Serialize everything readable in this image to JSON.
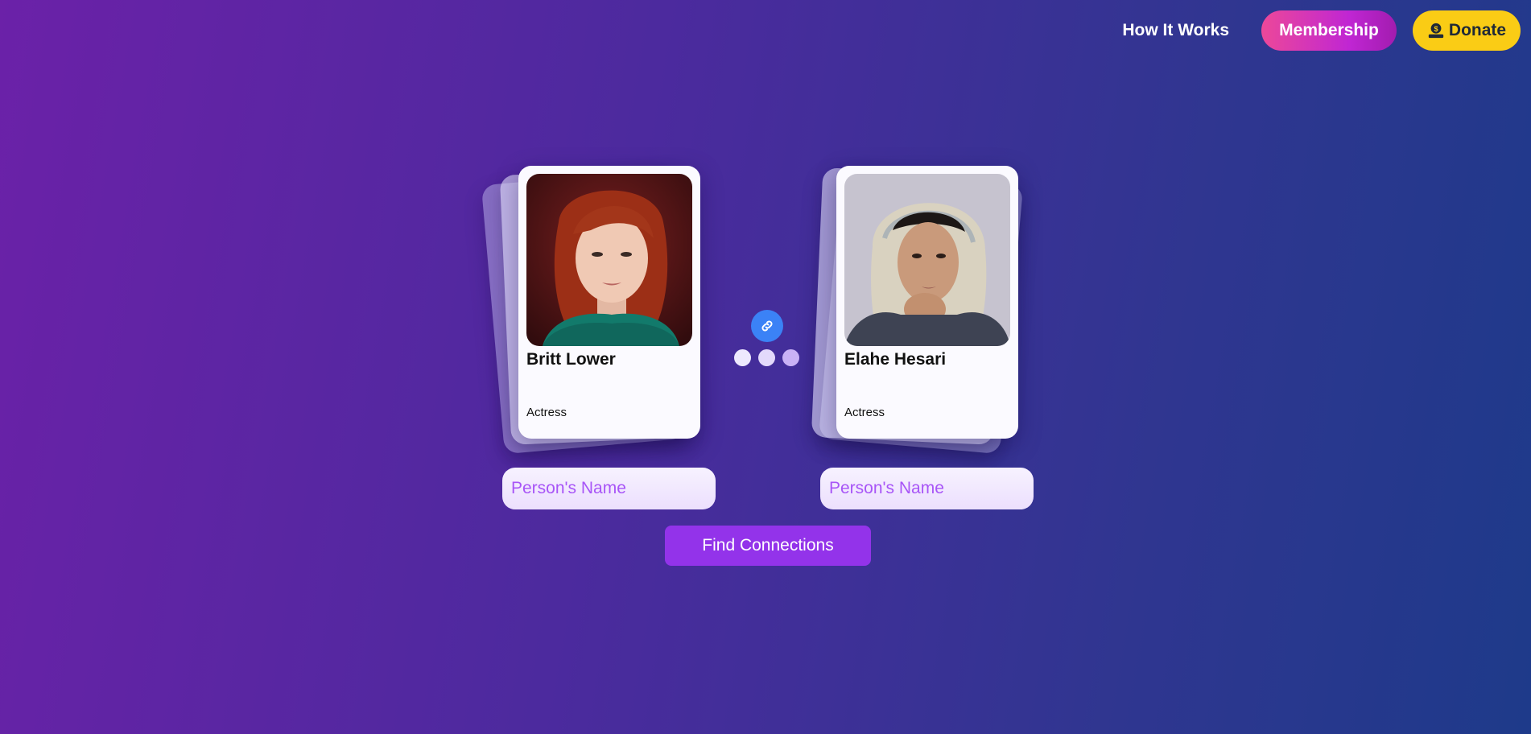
{
  "nav": {
    "how_it_works": "How It Works",
    "membership": "Membership",
    "donate": "Donate"
  },
  "people": [
    {
      "name": "Britt Lower",
      "role": "Actress",
      "photo_desc_icon": "portrait-red-hair"
    },
    {
      "name": "Elahe Hesari",
      "role": "Actress",
      "photo_desc_icon": "portrait-headscarf"
    }
  ],
  "inputs": {
    "left_placeholder": "Person's Name",
    "right_placeholder": "Person's Name"
  },
  "actions": {
    "find_connections": "Find Connections"
  },
  "colors": {
    "membership_gradient_start": "#ec4899",
    "membership_gradient_end": "#a21caf",
    "donate_bg": "#facc15",
    "link_badge": "#3b82f6",
    "primary_button": "#9333ea"
  }
}
